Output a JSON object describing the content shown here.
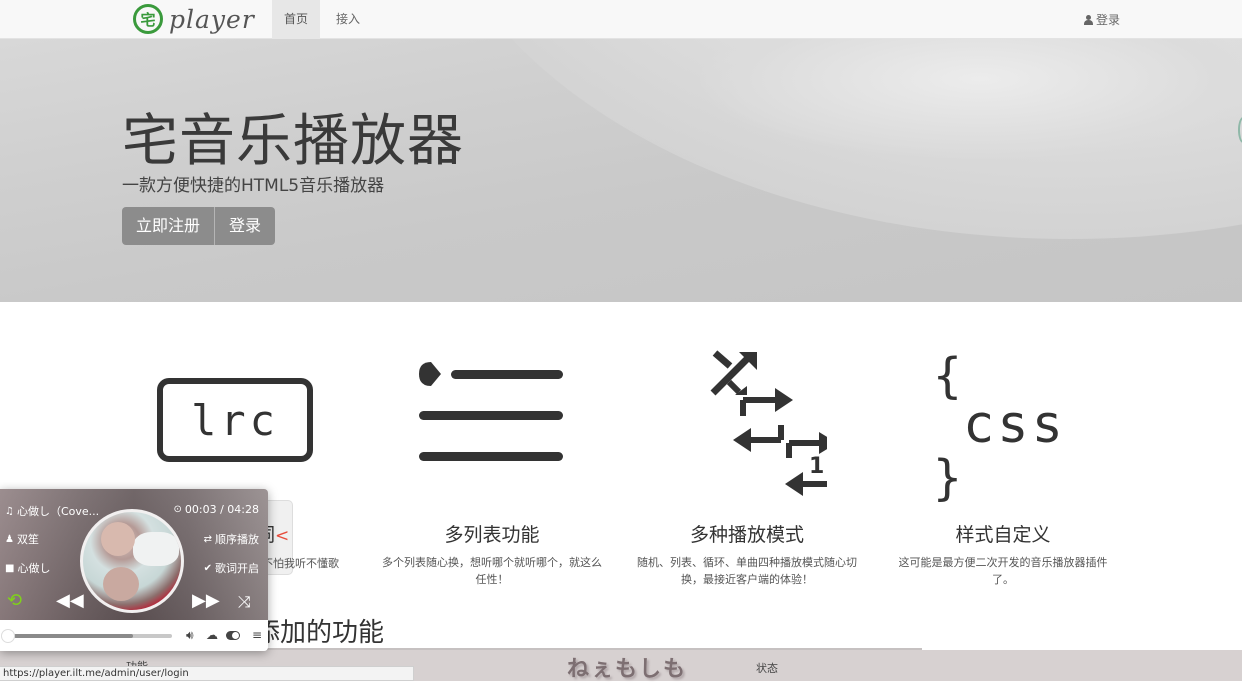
{
  "navbar": {
    "brand_logo_glyph": "宅",
    "brand_text": "player",
    "items": [
      {
        "label": "首页",
        "active": true
      },
      {
        "label": "接入",
        "active": false
      }
    ],
    "login_label": "登录",
    "login_icon": "user-icon"
  },
  "hero": {
    "title": "宅音乐播放器",
    "subtitle": "一款方便快捷的HTML5音乐播放器",
    "buttons": [
      {
        "label": "立即注册"
      },
      {
        "label": "登录"
      }
    ]
  },
  "features": [
    {
      "icon": "lrc-icon",
      "icon_text": "lrc",
      "title": "歌词",
      "desc": "不怕我听不懂歌"
    },
    {
      "icon": "list-icon",
      "title": "多列表功能",
      "desc": "多个列表随心换，想听哪个就听哪个，就这么任性！"
    },
    {
      "icon": "play-modes-icon",
      "icon_badge": "1",
      "title": "多种播放模式",
      "desc": "随机、列表、循环、单曲四种播放模式随心切换，最接近客户端的体验！"
    },
    {
      "icon": "css-icon",
      "icon_text": "css",
      "brace_open": "{",
      "brace_close": "}",
      "title": "样式自定义",
      "desc": "这可能是最方便二次开发的音乐播放器插件了。"
    }
  ],
  "peek": {
    "title_partial": "词",
    "arrow": "<",
    "desc_partial": "不怕我听不懂歌"
  },
  "section2": {
    "title": "未来可能会添加的功能",
    "title_visible": "添加的功能"
  },
  "bottom_band": {
    "feature_label": "功能",
    "logo_text": "ねぇもしも",
    "status_label": "状态"
  },
  "status_bar": {
    "url": "https://player.ilt.me/admin/user/login"
  },
  "player": {
    "song_title": "心做し（Cove...",
    "current_time": "00:03",
    "total_time": "04:28",
    "time_display": "00:03 / 04:28",
    "artist": "双笙",
    "album": "心做し",
    "play_mode": "顺序播放",
    "lyrics_status": "歌词开启",
    "progress_fraction": 0.75,
    "accent_color": "#7fd21a",
    "icons": {
      "title": "music-note-icon",
      "time": "clock-icon",
      "artist": "user-icon",
      "mode": "repeat-icon",
      "album": "folder-icon",
      "lyrics": "check-circle-icon"
    }
  }
}
